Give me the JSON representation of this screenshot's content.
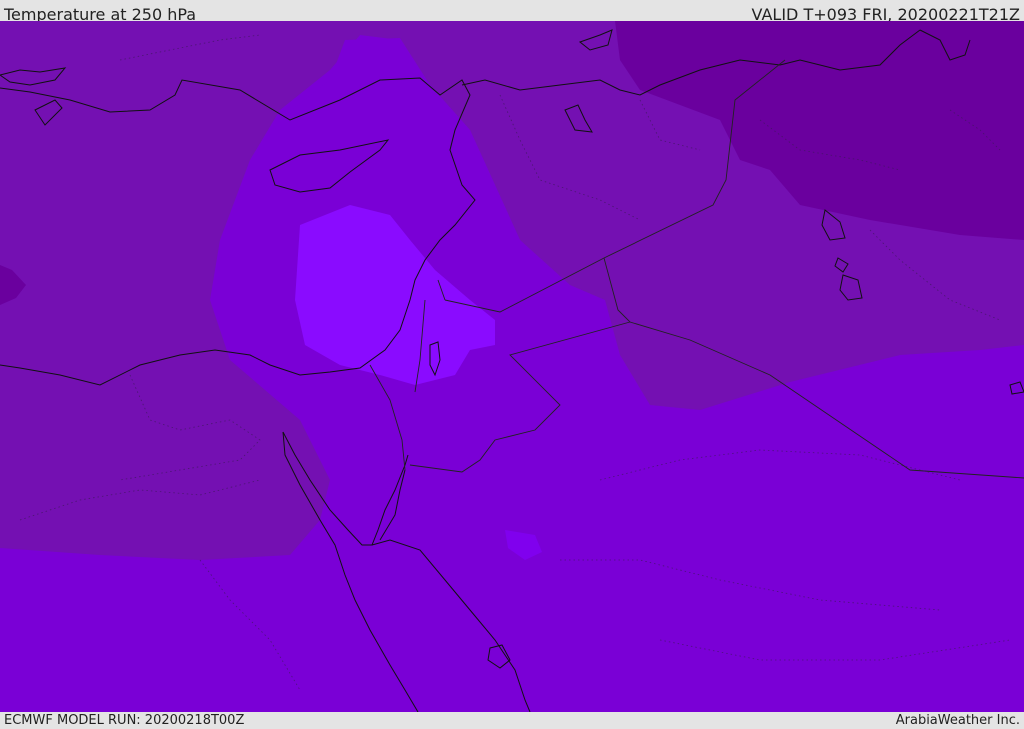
{
  "header": {
    "title": "Temperature at 250 hPa",
    "valid": "VALID T+093 FRI, 20200221T21Z"
  },
  "footer": {
    "model_run": "ECMWF MODEL RUN: 20200218T00Z",
    "credit": "ArabiaWeather Inc."
  },
  "map": {
    "field": "Temperature at 250 hPa",
    "palette": {
      "coldest": "#6a009e",
      "cold": "#7410b2",
      "mid": "#7a00d6",
      "warm": "#8000ee",
      "warmest": "#8a0bff",
      "coastline": "#111111",
      "border": "#222222"
    }
  }
}
